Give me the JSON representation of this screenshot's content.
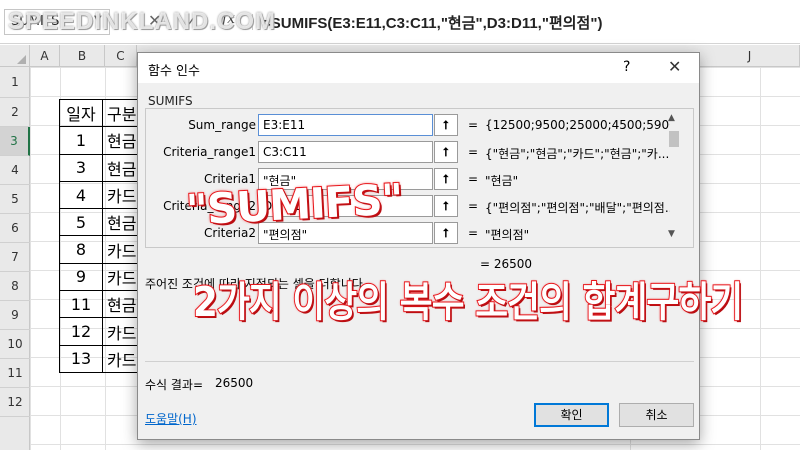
{
  "formula_bar": {
    "name_box": "SUMIFS",
    "cancel_icon": "✕",
    "enter_icon": "✓",
    "fx_label": "fx",
    "formula": "=SUMIFS(E3:E11,C3:C11,\"현금\",D3:D11,\"편의점\")"
  },
  "watermark": "SPEEDINKLAND.COM",
  "sheet": {
    "columns": [
      "A",
      "B",
      "C",
      "J"
    ],
    "rows": [
      "1",
      "2",
      "3",
      "4",
      "5",
      "6",
      "7",
      "8",
      "9",
      "10",
      "11",
      "12"
    ],
    "selected_row": "3"
  },
  "table": {
    "header": [
      "일자",
      "구분"
    ],
    "rows": [
      [
        "1",
        "현금"
      ],
      [
        "3",
        "현금"
      ],
      [
        "4",
        "카드"
      ],
      [
        "5",
        "현금"
      ],
      [
        "8",
        "카드"
      ],
      [
        "9",
        "카드"
      ],
      [
        "11",
        "현금"
      ],
      [
        "12",
        "카드"
      ],
      [
        "13",
        "카드"
      ]
    ]
  },
  "dialog": {
    "title": "함수 인수",
    "help_icon": "?",
    "close_icon": "✕",
    "function_name": "SUMIFS",
    "args": [
      {
        "label": "Sum_range",
        "input": "E3:E11",
        "value": "{12500;9500;25000;4500;5900..."
      },
      {
        "label": "Criteria_range1",
        "input": "C3:C11",
        "value": "{\"현금\";\"현금\";\"카드\";\"현금\";\"카..."
      },
      {
        "label": "Criteria1",
        "input": "\"현금\"",
        "value": "\"현금\""
      },
      {
        "label": "Criteria_range2",
        "input": "D3:D11",
        "value": "{\"편의점\";\"편의점\";\"배달\";\"편의점..."
      },
      {
        "label": "Criteria2",
        "input": "\"편의점\"",
        "value": "\"편의점\""
      }
    ],
    "result_eq": "= 26500",
    "description": "주어진 조건에 따라 지정되는 셀을 더합니다.",
    "formula_result_label": "수식 결과=",
    "formula_result_value": "26500",
    "help_link": "도움말(H)",
    "ok_label": "확인",
    "cancel_label": "취소"
  },
  "caption": {
    "line1": "\"SUMIFS\"",
    "line2": "2가지 이상의 복수 조건의 합계구하기",
    "color": "#e8161b"
  }
}
